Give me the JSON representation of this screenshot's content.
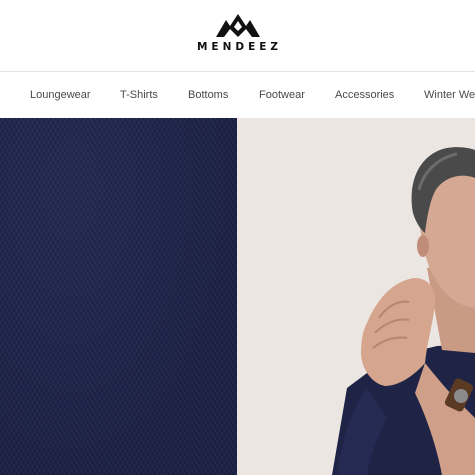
{
  "brand": {
    "name": "MENDEEZ",
    "logo_icon": "crown-mountain-icon"
  },
  "nav": {
    "items": [
      "Loungewear",
      "T-Shirts",
      "Bottoms",
      "Footwear",
      "Accessories",
      "Winter Wea"
    ]
  },
  "hero": {
    "left_image": "navy-knit-fabric-texture",
    "right_image": "grey-haired-man-clasped-hands-wristwatch"
  },
  "colors": {
    "navy": "#1d2347",
    "backdrop": "#ece6e3",
    "nav_text": "#4a4a4a"
  }
}
